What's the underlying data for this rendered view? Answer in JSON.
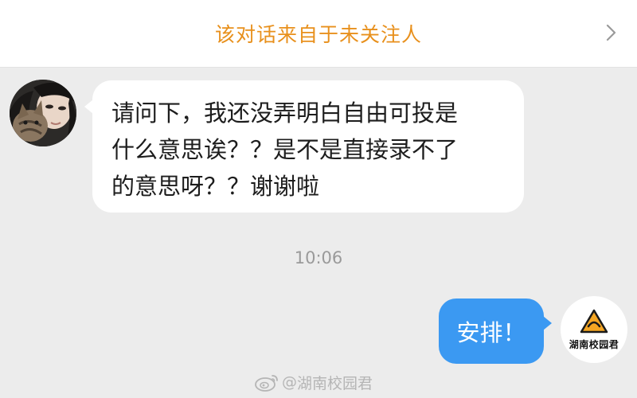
{
  "header": {
    "notice": "该对话来自于未关注人",
    "chevron_icon": "chevron-right-icon"
  },
  "conversation": {
    "incoming": {
      "avatar": "user-avatar-photo",
      "lines": [
        "请问下，我还没弄明白自由可投是",
        "什么意思诶？？是不是直接录不了",
        "的意思呀？？谢谢啦"
      ]
    },
    "timestamp": "10:06",
    "outgoing": {
      "text": "安排！",
      "avatar_brand": "湖南校园君"
    }
  },
  "watermark": {
    "at": "@",
    "name": "湖南校园君",
    "icon": "weibo-icon"
  },
  "colors": {
    "notice_orange": "#e8901c",
    "page_background": "#ececec",
    "outgoing_bubble": "#3b99f2",
    "incoming_bubble": "#ffffff",
    "brand_logo": "#f5a623"
  }
}
